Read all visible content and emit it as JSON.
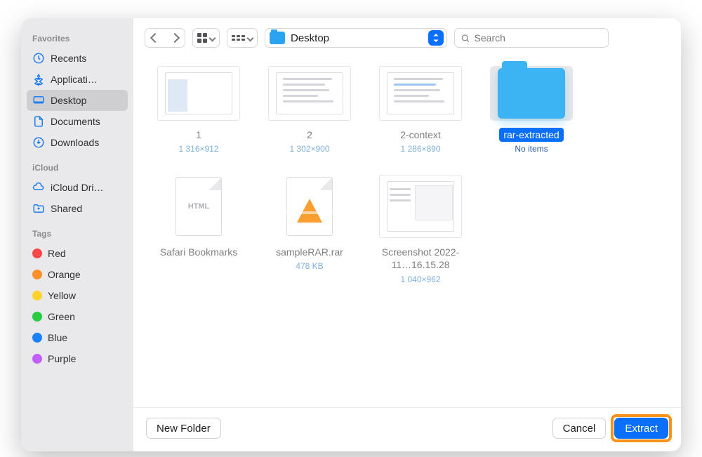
{
  "sidebar": {
    "sections": [
      {
        "header": "Favorites",
        "items": [
          {
            "label": "Recents",
            "icon": "clock-icon",
            "selected": false
          },
          {
            "label": "Applicati…",
            "icon": "apps-icon",
            "selected": false
          },
          {
            "label": "Desktop",
            "icon": "desktop-icon",
            "selected": true
          },
          {
            "label": "Documents",
            "icon": "document-icon",
            "selected": false
          },
          {
            "label": "Downloads",
            "icon": "download-icon",
            "selected": false
          }
        ]
      },
      {
        "header": "iCloud",
        "items": [
          {
            "label": "iCloud Dri…",
            "icon": "cloud-icon",
            "selected": false
          },
          {
            "label": "Shared",
            "icon": "shared-folder-icon",
            "selected": false
          }
        ]
      },
      {
        "header": "Tags",
        "items": [
          {
            "label": "Red",
            "icon": "tag-dot",
            "color": "#fb4848"
          },
          {
            "label": "Orange",
            "icon": "tag-dot",
            "color": "#fd9128"
          },
          {
            "label": "Yellow",
            "icon": "tag-dot",
            "color": "#ffd22e"
          },
          {
            "label": "Green",
            "icon": "tag-dot",
            "color": "#29cd41"
          },
          {
            "label": "Blue",
            "icon": "tag-dot",
            "color": "#1a81ff"
          },
          {
            "label": "Purple",
            "icon": "tag-dot",
            "color": "#c260ff"
          }
        ]
      }
    ]
  },
  "toolbar": {
    "location_label": "Desktop",
    "search_placeholder": "Search"
  },
  "files": [
    {
      "kind": "screenshot-window",
      "name": "1",
      "meta": "1 316×912",
      "selected": false
    },
    {
      "kind": "screenshot-text",
      "name": "2",
      "meta": "1 302×900",
      "selected": false
    },
    {
      "kind": "screenshot-text",
      "name": "2-context",
      "meta": "1 286×890",
      "selected": false
    },
    {
      "kind": "folder",
      "name": "rar-extracted",
      "meta": "No items",
      "selected": true
    },
    {
      "kind": "html-file",
      "name": "Safari Bookmarks",
      "meta": "",
      "selected": false
    },
    {
      "kind": "rar-file",
      "name": "sampleRAR.rar",
      "meta": "478 KB",
      "selected": false
    },
    {
      "kind": "screenshot-app",
      "name": "Screenshot 2022-11…16.15.28",
      "meta": "1 040×962",
      "selected": false
    }
  ],
  "footer": {
    "newfolder_label": "New Folder",
    "cancel_label": "Cancel",
    "confirm_label": "Extract"
  }
}
